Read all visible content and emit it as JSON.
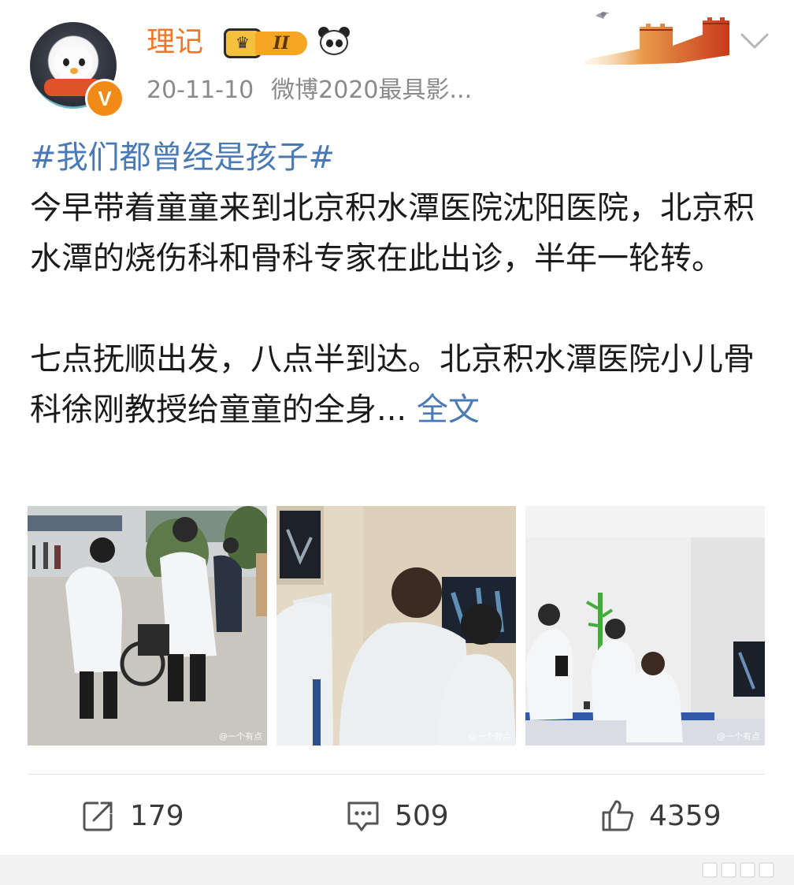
{
  "post": {
    "username": "理记",
    "level_label": "II",
    "verified_mark": "V",
    "time": "20-11-10",
    "source": "微博2020最具影...",
    "topic": "#我们都曾经是孩子#",
    "paragraph1": "今早带着童童来到北京积水潭医院沈阳医院，北京积水潭的烧伤科和骨科专家在此出诊，半年一轮转。",
    "paragraph2": "七点抚顺出发，八点半到达。北京积水潭医院小儿骨科徐刚教授给童童的全身... ",
    "more_label": "全文",
    "photo_watermark": "@一个有点"
  },
  "actions": {
    "repost_count": "179",
    "comment_count": "509",
    "like_count": "4359"
  },
  "icons": {
    "avatar": "penguin-avatar",
    "verified": "verified-badge-icon",
    "level": "crown-level-icon",
    "emoji": "panda-icon",
    "decoration": "great-wall-icon",
    "menu": "chevron-down-icon",
    "repost": "repost-icon",
    "comment": "comment-icon",
    "like": "like-icon"
  },
  "colors": {
    "username": "#f0772a",
    "link": "#4a7ab5",
    "text": "#1a1a1a",
    "meta": "#8a8a8a",
    "verified": "#f28b16"
  }
}
